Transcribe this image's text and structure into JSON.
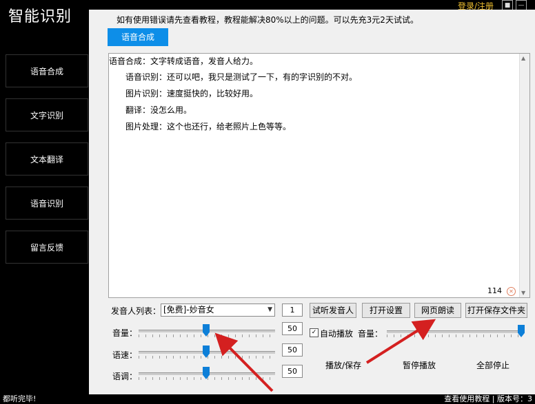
{
  "app": {
    "title": "智能识别",
    "login": "登录/注册"
  },
  "notice": "如有使用错误请先查看教程，教程能解决80%以上的问题。可以先充3元2天试试。",
  "tab": "语音合成",
  "sidebar": {
    "items": [
      "语音合成",
      "文字识别",
      "文本翻译",
      "语音识别",
      "留言反馈"
    ]
  },
  "textbox": {
    "lines": [
      "语音合成：文字转成语音，发音人给力。",
      "语音识别：还可以吧，我只是测试了一下，有的字识别的不对。",
      "图片识别：速度挺快的，比较好用。",
      "翻译：没怎么用。",
      "图片处理：这个也还行，给老照片上色等等。"
    ],
    "char_count": "114"
  },
  "controls": {
    "speaker_label": "发音人列表：",
    "speaker_value": "[免费]-妙音女",
    "speaker_count": "1",
    "volume_label": "音量：",
    "volume_value": "50",
    "speed_label": "语速：",
    "speed_value": "50",
    "pitch_label": "语调：",
    "pitch_value": "50",
    "listen_button": "试听发音人",
    "open_settings": "打开设置",
    "web_read": "网页朗读",
    "open_folder": "打开保存文件夹",
    "autoplay_label": "自动播放",
    "play_volume_label": "音量：",
    "play_save": "播放/保存",
    "pause": "暂停播放",
    "stop_all": "全部停止"
  },
  "status": {
    "left": "都听完毕!",
    "right": "查看使用教程 | 版本号：3"
  },
  "colors": {
    "accent": "#0d8ee8",
    "arrow": "#d42020"
  },
  "icons": [
    "shirt-icon",
    "minimize-icon"
  ]
}
